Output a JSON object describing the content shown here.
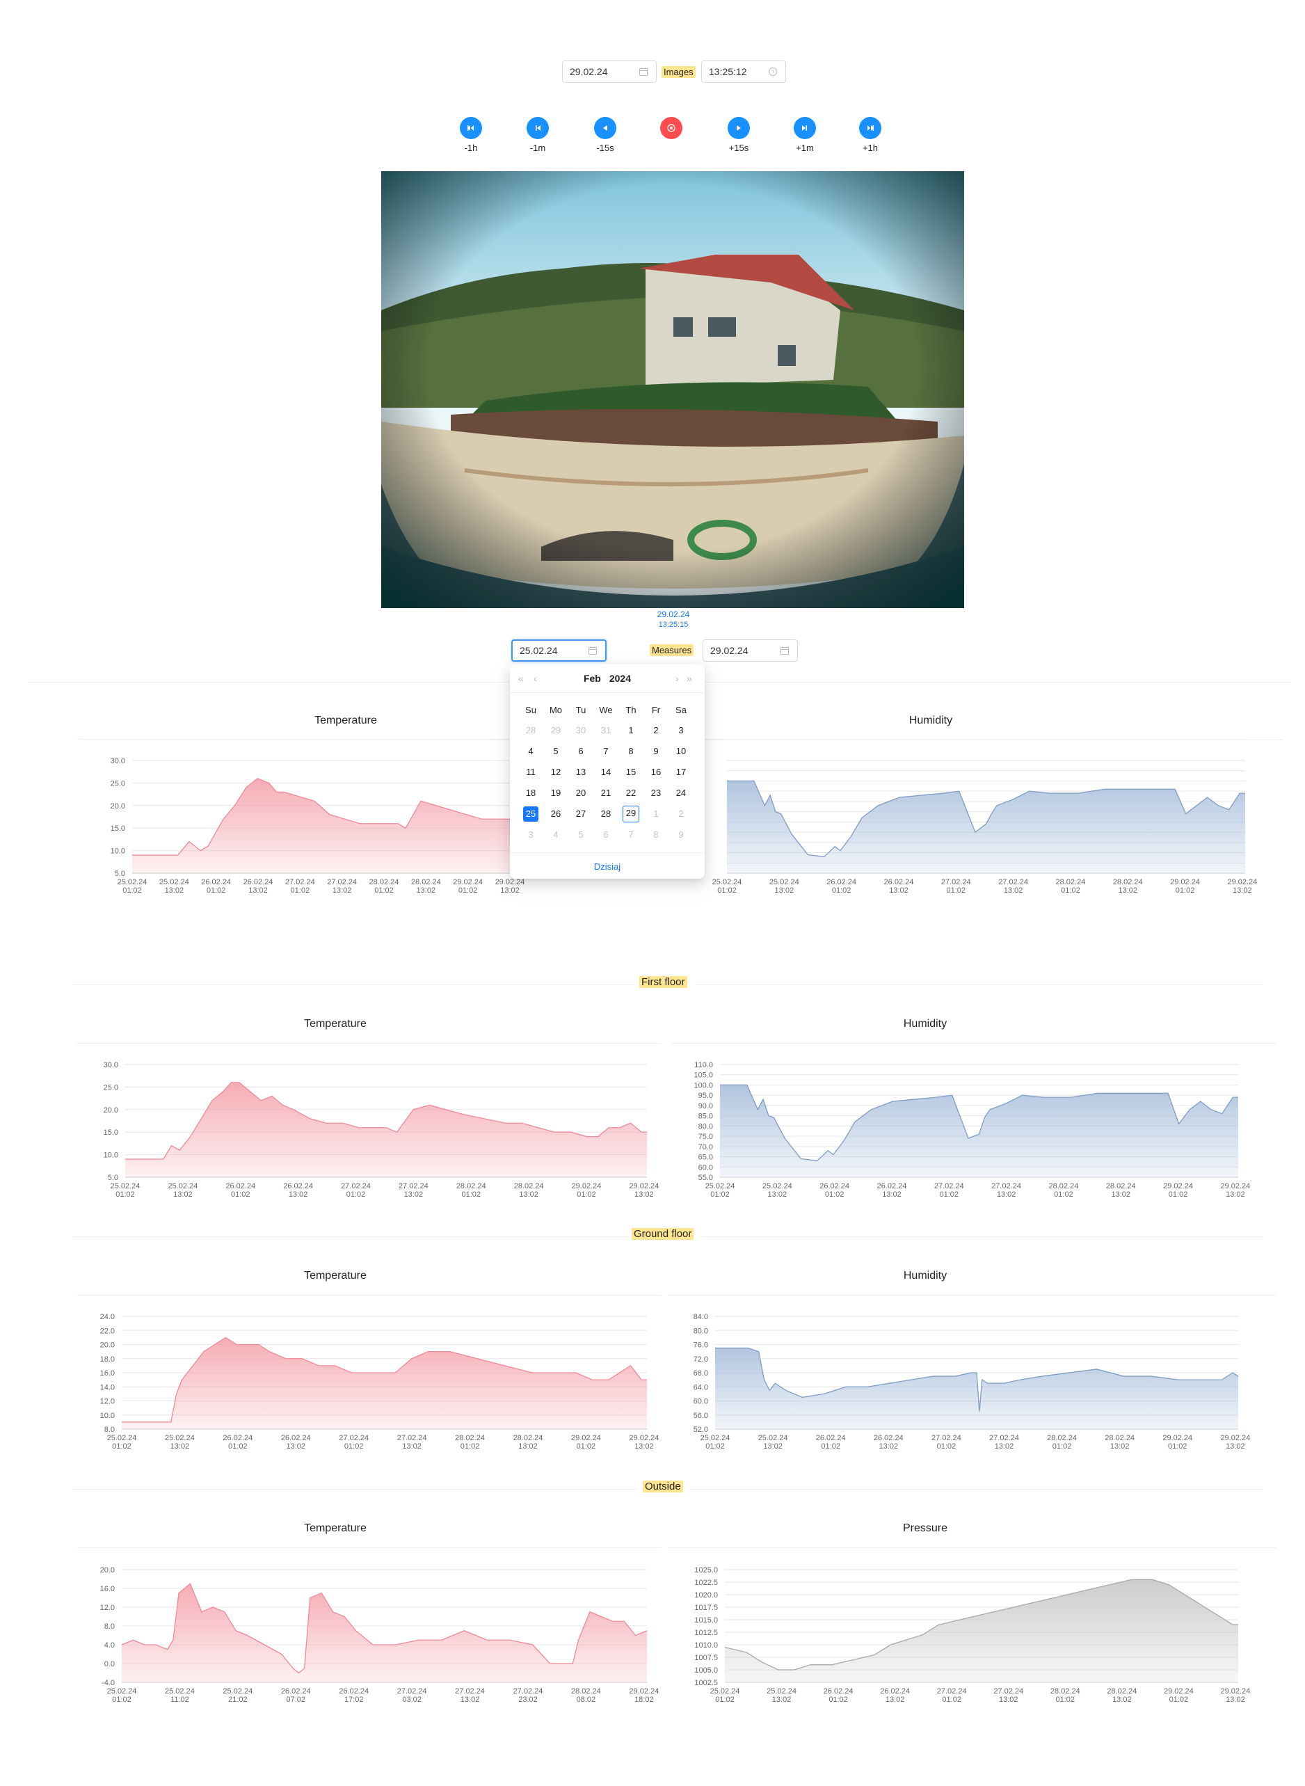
{
  "top": {
    "date": "29.02.24",
    "label": "Images",
    "time": "13:25:12"
  },
  "nav": [
    {
      "label": "-1h",
      "icon": "skip-back-icon"
    },
    {
      "label": "-1m",
      "icon": "step-back-icon"
    },
    {
      "label": "-15s",
      "icon": "play-back-icon"
    },
    {
      "label": "",
      "icon": "close-circle-icon"
    },
    {
      "label": "+15s",
      "icon": "play-icon"
    },
    {
      "label": "+1m",
      "icon": "step-forward-icon"
    },
    {
      "label": "+1h",
      "icon": "skip-forward-icon"
    }
  ],
  "image": {
    "date": "29.02.24",
    "time": "13:25:15"
  },
  "measures": {
    "from": "25.02.24",
    "label": "Measures",
    "to": "29.02.24"
  },
  "calendar": {
    "month": "Feb",
    "year": "2024",
    "weekdays": [
      "Su",
      "Mo",
      "Tu",
      "We",
      "Th",
      "Fr",
      "Sa"
    ],
    "weeks": [
      [
        "28",
        "29",
        "30",
        "31",
        "1",
        "2",
        "3"
      ],
      [
        "4",
        "5",
        "6",
        "7",
        "8",
        "9",
        "10"
      ],
      [
        "11",
        "12",
        "13",
        "14",
        "15",
        "16",
        "17"
      ],
      [
        "18",
        "19",
        "20",
        "21",
        "22",
        "23",
        "24"
      ],
      [
        "25",
        "26",
        "27",
        "28",
        "29",
        "1",
        "2"
      ],
      [
        "3",
        "4",
        "5",
        "6",
        "7",
        "8",
        "9"
      ]
    ],
    "selected": "25",
    "today": "29",
    "footer": "Dzisiaj"
  },
  "sections": {
    "first_floor": "First floor",
    "ground_floor": "Ground floor",
    "outside": "Outside"
  },
  "chart_data": [
    {
      "id": "top-temperature",
      "type": "area",
      "title": "Temperature",
      "color": "#f4a3ac",
      "ylim": [
        5,
        30
      ],
      "yticks": [
        "5.0",
        "10.0",
        "15.0",
        "20.0",
        "25.0",
        "30.0"
      ],
      "xticks": [
        "25.02.24|01:02",
        "25.02.24|13:02",
        "26.02.24|01:02",
        "26.02.24|13:02",
        "27.02.24|01:02",
        "27.02.24|13:02",
        "28.02.24|01:02",
        "28.02.24|13:02",
        "29.02.24|01:02",
        "29.02.24|13:02"
      ],
      "x": [
        0,
        0.3,
        0.6,
        0.75,
        0.9,
        1.0,
        1.1,
        1.2,
        1.35,
        1.5,
        1.65,
        1.8,
        1.9,
        2.0,
        2.2,
        2.4,
        2.6,
        2.8,
        3.0,
        3.2,
        3.4,
        3.5,
        3.6,
        3.8,
        4.0,
        4.2,
        4.4,
        4.6,
        4.8,
        5.0
      ],
      "values": [
        9,
        9,
        9,
        12,
        10,
        11,
        14,
        17,
        20,
        24,
        26,
        25,
        23,
        23,
        22,
        21,
        18,
        17,
        16,
        16,
        16,
        16,
        15,
        21,
        20,
        19,
        18,
        17,
        17,
        17
      ]
    },
    {
      "id": "top-humidity",
      "type": "area",
      "title": "Humidity",
      "color": "#a9bfdc",
      "ylim": [
        55,
        110
      ],
      "yticks": [],
      "xticks": [
        "25.02.24|01:02",
        "25.02.24|13:02",
        "26.02.24|01:02",
        "26.02.24|13:02",
        "27.02.24|01:02",
        "27.02.24|13:02",
        "28.02.24|01:02",
        "28.02.24|13:02",
        "29.02.24|01:02",
        "29.02.24|13:02"
      ],
      "x": [
        0,
        0.5,
        0.7,
        0.8,
        0.9,
        1.0,
        1.2,
        1.5,
        1.8,
        2.0,
        2.1,
        2.3,
        2.5,
        2.8,
        3.2,
        3.6,
        4.0,
        4.3,
        4.6,
        4.8,
        4.9,
        5.0,
        5.3,
        5.6,
        6.0,
        6.5,
        7.0,
        7.5,
        8.0,
        8.3,
        8.5,
        8.7,
        8.9,
        9.1,
        9.3,
        9.5,
        9.6
      ],
      "values": [
        100,
        100,
        88,
        93,
        85,
        84,
        74,
        64,
        63,
        68,
        66,
        73,
        82,
        88,
        92,
        93,
        94,
        95,
        75,
        79,
        84,
        88,
        91,
        95,
        94,
        94,
        96,
        96,
        96,
        96,
        84,
        88,
        92,
        88,
        86,
        94,
        94
      ]
    },
    {
      "id": "first-temperature",
      "type": "area",
      "title": "Temperature",
      "color": "#f4a3ac",
      "ylim": [
        5,
        30
      ],
      "yticks": [
        "5.0",
        "10.0",
        "15.0",
        "20.0",
        "25.0",
        "30.0"
      ],
      "xticks": [
        "25.02.24|01:02",
        "25.02.24|13:02",
        "26.02.24|01:02",
        "26.02.24|13:02",
        "27.02.24|01:02",
        "27.02.24|13:02",
        "28.02.24|01:02",
        "28.02.24|13:02",
        "29.02.24|01:02",
        "29.02.24|13:02"
      ],
      "x": [
        0,
        0.5,
        0.7,
        0.85,
        1.0,
        1.2,
        1.4,
        1.6,
        1.8,
        1.95,
        2.1,
        2.3,
        2.5,
        2.7,
        2.9,
        3.1,
        3.4,
        3.7,
        4.0,
        4.3,
        4.6,
        4.8,
        5.0,
        5.3,
        5.6,
        5.9,
        6.2,
        6.6,
        7.0,
        7.3,
        7.6,
        7.9,
        8.2,
        8.5,
        8.7,
        8.9,
        9.1,
        9.3,
        9.5,
        9.6
      ],
      "values": [
        9,
        9,
        9,
        12,
        11,
        14,
        18,
        22,
        24,
        26,
        26,
        24,
        22,
        23,
        21,
        20,
        18,
        17,
        17,
        16,
        16,
        16,
        15,
        20,
        21,
        20,
        19,
        18,
        17,
        17,
        16,
        15,
        15,
        14,
        14,
        16,
        16,
        17,
        15,
        15
      ]
    },
    {
      "id": "first-humidity",
      "type": "area",
      "title": "Humidity",
      "color": "#a9bfdc",
      "ylim": [
        55,
        110
      ],
      "yticks": [
        "55.0",
        "60.0",
        "65.0",
        "70.0",
        "75.0",
        "80.0",
        "85.0",
        "90.0",
        "95.0",
        "100.0",
        "105.0",
        "110.0"
      ],
      "xticks": [
        "25.02.24|01:02",
        "25.02.24|13:02",
        "26.02.24|01:02",
        "26.02.24|13:02",
        "27.02.24|01:02",
        "27.02.24|13:02",
        "28.02.24|01:02",
        "28.02.24|13:02",
        "29.02.24|01:02",
        "29.02.24|13:02"
      ],
      "x": [
        0,
        0.5,
        0.7,
        0.8,
        0.9,
        1.0,
        1.2,
        1.5,
        1.8,
        2.0,
        2.1,
        2.3,
        2.5,
        2.8,
        3.2,
        3.6,
        4.0,
        4.3,
        4.6,
        4.8,
        4.9,
        5.0,
        5.3,
        5.6,
        6.0,
        6.5,
        7.0,
        7.5,
        8.0,
        8.3,
        8.5,
        8.7,
        8.9,
        9.1,
        9.3,
        9.5,
        9.6
      ],
      "values": [
        100,
        100,
        88,
        93,
        85,
        84,
        74,
        64,
        63,
        68,
        66,
        73,
        82,
        88,
        92,
        93,
        94,
        95,
        74,
        76,
        84,
        88,
        91,
        95,
        94,
        94,
        96,
        96,
        96,
        96,
        81,
        88,
        92,
        88,
        86,
        94,
        94
      ]
    },
    {
      "id": "ground-temperature",
      "type": "area",
      "title": "Temperature",
      "color": "#f4a3ac",
      "ylim": [
        8,
        24
      ],
      "yticks": [
        "8.0",
        "10.0",
        "12.0",
        "14.0",
        "16.0",
        "18.0",
        "20.0",
        "22.0",
        "24.0"
      ],
      "xticks": [
        "25.02.24|01:02",
        "25.02.24|13:02",
        "26.02.24|01:02",
        "26.02.24|13:02",
        "27.02.24|01:02",
        "27.02.24|13:02",
        "28.02.24|01:02",
        "28.02.24|13:02",
        "29.02.24|01:02",
        "29.02.24|13:02"
      ],
      "x": [
        0,
        0.8,
        0.9,
        1.0,
        1.1,
        1.3,
        1.5,
        1.7,
        1.9,
        2.1,
        2.3,
        2.5,
        2.7,
        3.0,
        3.3,
        3.6,
        3.9,
        4.2,
        4.6,
        5.0,
        5.3,
        5.6,
        6.0,
        6.5,
        7.0,
        7.5,
        8.0,
        8.3,
        8.6,
        8.9,
        9.1,
        9.3,
        9.5,
        9.6
      ],
      "values": [
        9,
        9,
        9,
        13,
        15,
        17,
        19,
        20,
        21,
        20,
        20,
        20,
        19,
        18,
        18,
        17,
        17,
        16,
        16,
        16,
        18,
        19,
        19,
        18,
        17,
        16,
        16,
        16,
        15,
        15,
        16,
        17,
        15,
        15
      ]
    },
    {
      "id": "ground-humidity",
      "type": "area",
      "title": "Humidity",
      "color": "#a9bfdc",
      "ylim": [
        52,
        84
      ],
      "yticks": [
        "52.0",
        "56.0",
        "60.0",
        "64.0",
        "68.0",
        "72.0",
        "76.0",
        "80.0",
        "84.0"
      ],
      "xticks": [
        "25.02.24|01:02",
        "25.02.24|13:02",
        "26.02.24|01:02",
        "26.02.24|13:02",
        "27.02.24|01:02",
        "27.02.24|13:02",
        "28.02.24|01:02",
        "28.02.24|13:02",
        "29.02.24|01:02",
        "29.02.24|13:02"
      ],
      "x": [
        0,
        0.6,
        0.8,
        0.9,
        1.0,
        1.1,
        1.3,
        1.6,
        2.0,
        2.4,
        2.8,
        3.2,
        3.6,
        4.0,
        4.4,
        4.7,
        4.8,
        4.85,
        4.9,
        5.0,
        5.3,
        5.6,
        6.0,
        6.5,
        7.0,
        7.5,
        8.0,
        8.5,
        9.0,
        9.3,
        9.5,
        9.6
      ],
      "values": [
        75,
        75,
        74,
        66,
        63,
        65,
        63,
        61,
        62,
        64,
        64,
        65,
        66,
        67,
        67,
        68,
        68,
        57,
        66,
        65,
        65,
        66,
        67,
        68,
        69,
        67,
        67,
        66,
        66,
        66,
        68,
        67
      ]
    },
    {
      "id": "outside-temperature",
      "type": "area",
      "title": "Temperature",
      "color": "#f4a3ac",
      "ylim": [
        -4,
        20
      ],
      "yticks": [
        "-4.0",
        "0.0",
        "4.0",
        "8.0",
        "12.0",
        "16.0",
        "20.0"
      ],
      "xticks": [
        "25.02.24|01:02",
        "25.02.24|11:02",
        "25.02.24|21:02",
        "26.02.24|07:02",
        "26.02.24|17:02",
        "27.02.24|03:02",
        "27.02.24|13:02",
        "27.02.24|23:02",
        "28.02.24|08:02",
        "29.02.24|18:02"
      ],
      "x": [
        0,
        0.2,
        0.4,
        0.6,
        0.8,
        0.9,
        1.0,
        1.2,
        1.4,
        1.6,
        1.8,
        2.0,
        2.2,
        2.5,
        2.8,
        3.0,
        3.1,
        3.2,
        3.3,
        3.5,
        3.7,
        3.9,
        4.1,
        4.4,
        4.8,
        5.2,
        5.6,
        6.0,
        6.4,
        6.8,
        7.2,
        7.5,
        7.7,
        7.9,
        8.0,
        8.2,
        8.4,
        8.6,
        8.8,
        9.0,
        9.2
      ],
      "values": [
        4,
        5,
        4,
        4,
        3,
        5,
        15,
        17,
        11,
        12,
        11,
        7,
        6,
        4,
        2,
        -1,
        -2,
        -1,
        14,
        15,
        11,
        10,
        7,
        4,
        4,
        5,
        5,
        7,
        5,
        5,
        4,
        0,
        0,
        0,
        5,
        11,
        10,
        9,
        9,
        6,
        7
      ]
    },
    {
      "id": "outside-pressure",
      "type": "area",
      "title": "Pressure",
      "color": "#c7c7c7",
      "ylim": [
        1002.5,
        1025
      ],
      "yticks": [
        "1002.5",
        "1005.0",
        "1007.5",
        "1010.0",
        "1012.5",
        "1015.0",
        "1017.5",
        "1020.0",
        "1022.5",
        "1025.0"
      ],
      "xticks": [
        "25.02.24|01:02",
        "25.02.24|13:02",
        "26.02.24|01:02",
        "26.02.24|13:02",
        "27.02.24|01:02",
        "27.02.24|13:02",
        "28.02.24|01:02",
        "28.02.24|13:02",
        "29.02.24|01:02",
        "29.02.24|13:02"
      ],
      "x": [
        0,
        0.4,
        0.7,
        1.0,
        1.3,
        1.6,
        2.0,
        2.4,
        2.8,
        3.1,
        3.4,
        3.7,
        4.0,
        4.4,
        4.8,
        5.2,
        5.6,
        6.0,
        6.4,
        6.8,
        7.2,
        7.6,
        8.0,
        8.3,
        8.6,
        8.9,
        9.2,
        9.5,
        9.6
      ],
      "values": [
        1009.5,
        1008.5,
        1006.5,
        1005,
        1005,
        1006,
        1006,
        1007,
        1008,
        1010,
        1011,
        1012,
        1014,
        1015,
        1016,
        1017,
        1018,
        1019,
        1020,
        1021,
        1022,
        1023,
        1023,
        1022,
        1020,
        1018,
        1016,
        1014,
        1014
      ]
    }
  ]
}
